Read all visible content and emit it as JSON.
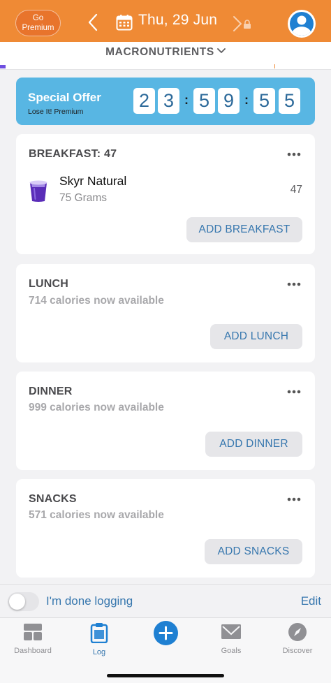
{
  "header": {
    "premium_line1": "Go",
    "premium_line2": "Premium",
    "date": "Thu, 29 Jun"
  },
  "macro": {
    "title": "MACRONUTRIENTS"
  },
  "offer": {
    "title": "Special Offer",
    "subtitle": "Lose It! Premium",
    "digits": [
      "2",
      "3",
      "5",
      "9",
      "5",
      "5"
    ],
    "separator": ":"
  },
  "meals": {
    "breakfast": {
      "title": "BREAKFAST: 47",
      "food_name": "Skyr Natural",
      "food_qty": "75 Grams",
      "food_cal": "47",
      "add_label": "ADD BREAKFAST"
    },
    "lunch": {
      "title": "LUNCH",
      "subtitle": "714 calories now available",
      "add_label": "ADD LUNCH"
    },
    "dinner": {
      "title": "DINNER",
      "subtitle": "999 calories now available",
      "add_label": "ADD DINNER"
    },
    "snacks": {
      "title": "SNACKS",
      "subtitle": "571 calories now available",
      "add_label": "ADD SNACKS"
    }
  },
  "done": {
    "label": "I'm done logging",
    "edit": "Edit"
  },
  "tabs": {
    "dashboard": "Dashboard",
    "log": "Log",
    "goals": "Goals",
    "discover": "Discover"
  },
  "colors": {
    "header": "#ef8a35",
    "offer": "#58b6e3",
    "link": "#3777ae",
    "accent": "#1f80d2"
  }
}
